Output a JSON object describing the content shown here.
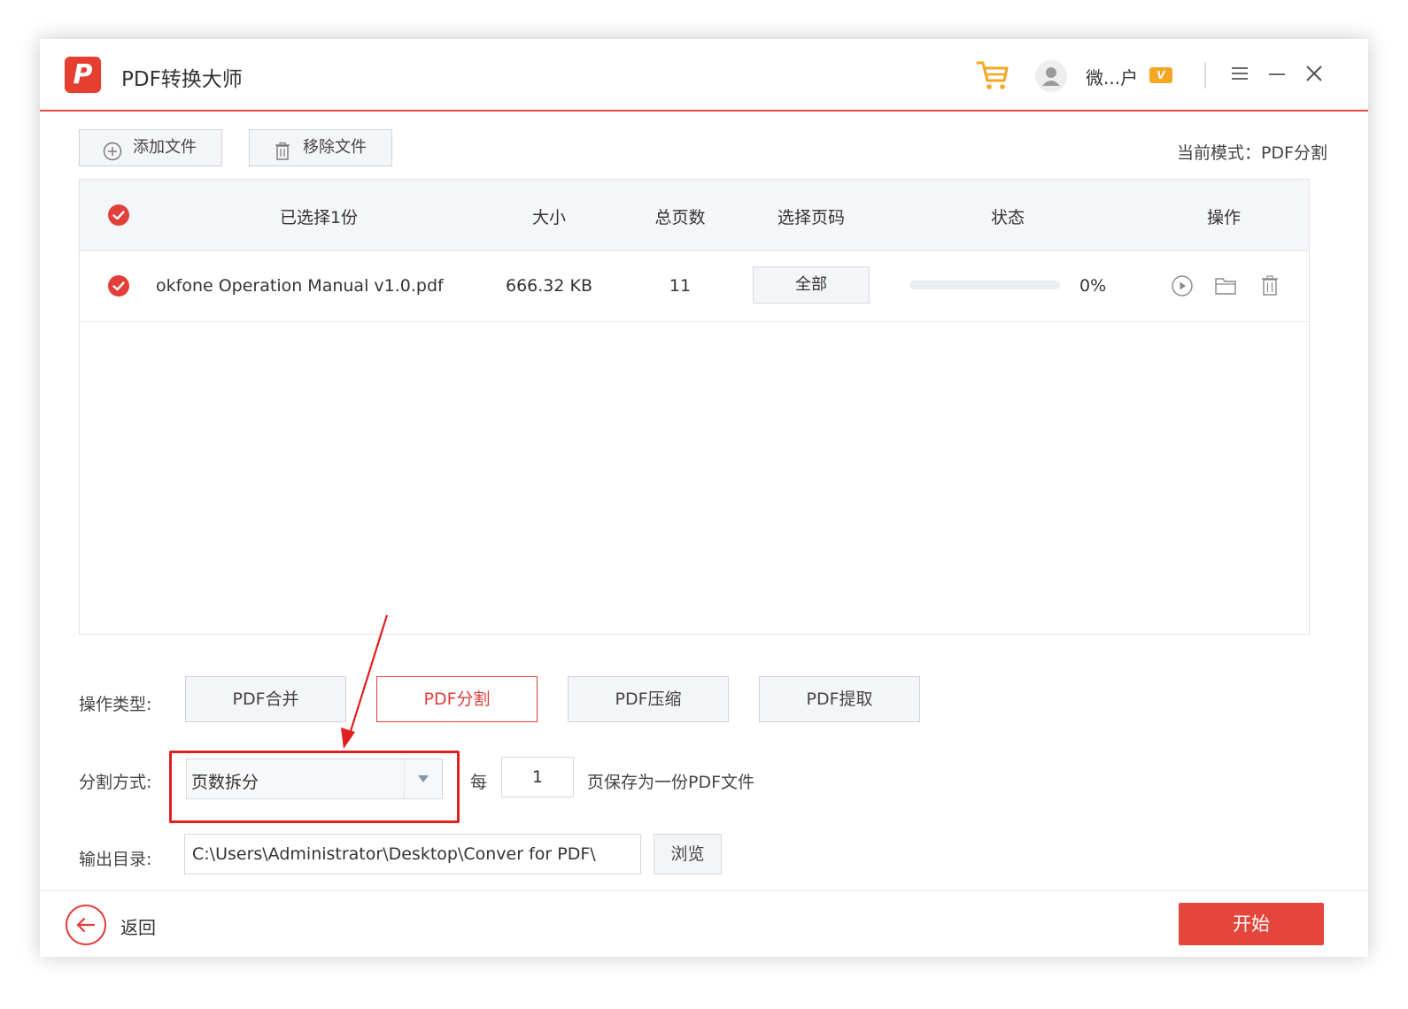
{
  "app": {
    "logo_letter": "P",
    "title": "PDF转换大师",
    "username": "微...户",
    "vip_badge": "V"
  },
  "toolbar": {
    "add_file": "添加文件",
    "remove_file": "移除文件",
    "current_mode": "当前模式：PDF分割"
  },
  "table": {
    "headers": {
      "selected": "已选择1份",
      "size": "大小",
      "total_pages": "总页数",
      "select_pages": "选择页码",
      "status": "状态",
      "actions": "操作"
    },
    "rows": [
      {
        "name": "okfone Operation Manual v1.0.pdf",
        "size": "666.32 KB",
        "pages": "11",
        "page_select": "全部",
        "progress_percent": 0,
        "progress_text": "0%"
      }
    ]
  },
  "settings": {
    "op_type_label": "操作类型:",
    "op_types": [
      "PDF合并",
      "PDF分割",
      "PDF压缩",
      "PDF提取"
    ],
    "active_op": "PDF分割",
    "split_label": "分割方式:",
    "split_value": "页数拆分",
    "every_label": "每",
    "every_value": "1",
    "every_suffix": "页保存为一份PDF文件",
    "output_label": "输出目录:",
    "output_path": "C:\\Users\\Administrator\\Desktop\\Conver for PDF\\",
    "browse": "浏览"
  },
  "footer": {
    "back": "返回",
    "start": "开始"
  },
  "colors": {
    "accent": "#e23e3a",
    "highlight": "#e01f1f",
    "cart": "#f5a623"
  }
}
